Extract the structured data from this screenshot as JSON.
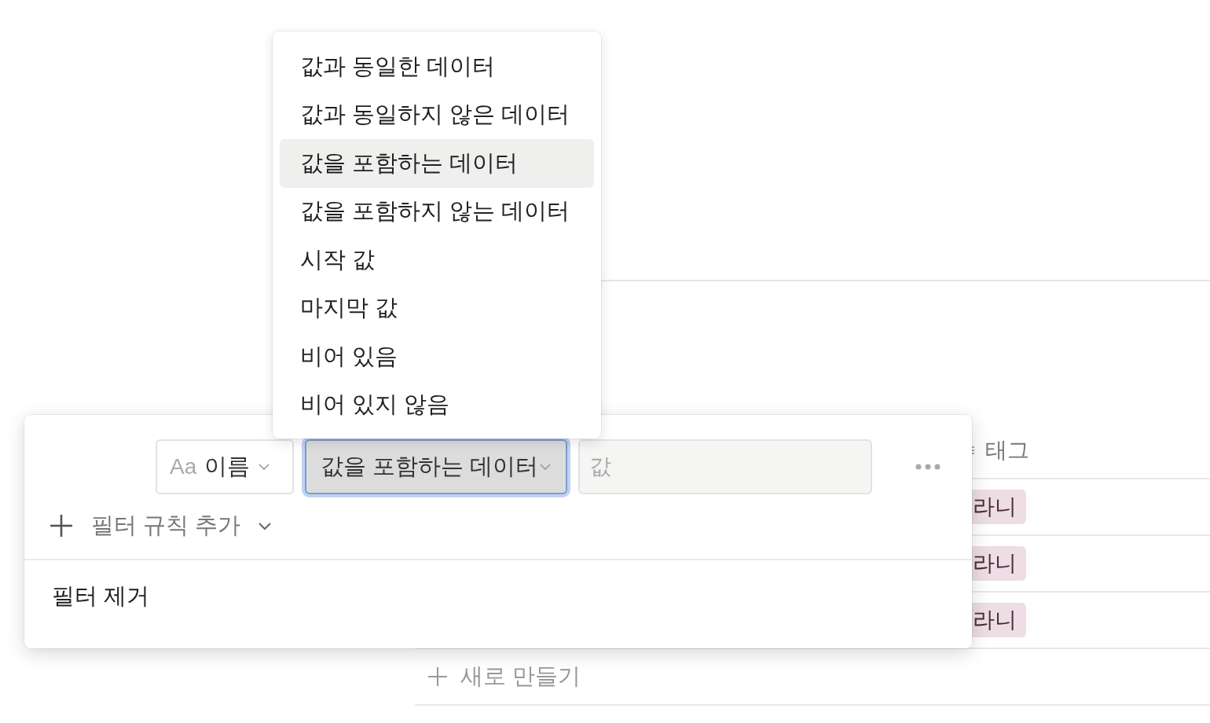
{
  "table": {
    "columns": [
      {
        "label": "태그"
      }
    ],
    "rows": [
      {
        "tag": "라니"
      },
      {
        "tag": "라니"
      },
      {
        "tag": "라니"
      }
    ],
    "new_row": "새로 만들기"
  },
  "filter": {
    "property": {
      "type_label": "Aa",
      "label": "이름"
    },
    "condition": {
      "label": "값을 포함하는 데이터",
      "focused": true
    },
    "value": {
      "placeholder": "값"
    },
    "add_rule": "필터 규칙 추가",
    "remove": "필터 제거"
  },
  "menu": {
    "items": [
      {
        "label": "값과 동일한 데이터",
        "selected": false
      },
      {
        "label": "값과 동일하지 않은 데이터",
        "selected": false
      },
      {
        "label": "값을 포함하는 데이터",
        "selected": true
      },
      {
        "label": "값을 포함하지 않는 데이터",
        "selected": false
      },
      {
        "label": "시작 값",
        "selected": false
      },
      {
        "label": "마지막 값",
        "selected": false
      },
      {
        "label": "비어 있음",
        "selected": false
      },
      {
        "label": "비어 있지 않음",
        "selected": false
      }
    ]
  }
}
